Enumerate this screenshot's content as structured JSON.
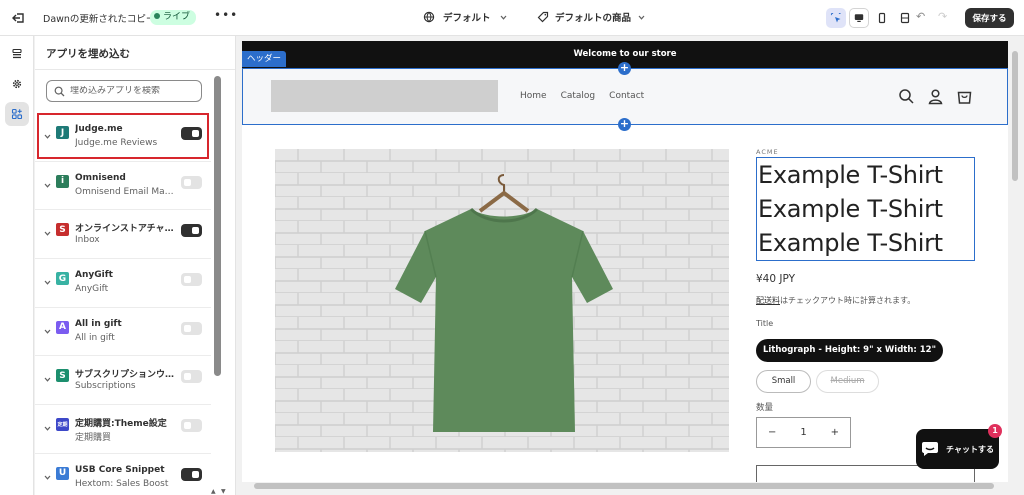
{
  "topbar": {
    "store_title": "Dawnの更新されたコピー",
    "live_label": "ライブ",
    "more_label": "•••",
    "theme_label": "デフォルト",
    "template_label": "デフォルトの商品",
    "save_label": "保存する"
  },
  "panel": {
    "title": "アプリを埋め込む",
    "search_placeholder": "埋め込みアプリを検索",
    "apps": [
      {
        "name": "Judge.me",
        "subtitle": "Judge.me Reviews",
        "enabled": true,
        "icon_letter": "J",
        "icon_color": "#1e7a77"
      },
      {
        "name": "Omnisend",
        "subtitle": "Omnisend Email Marketing",
        "enabled": false,
        "icon_letter": "i",
        "icon_color": "#2c7d5b"
      },
      {
        "name": "オンラインストアチャット",
        "subtitle": "Inbox",
        "enabled": true,
        "icon_letter": "S",
        "icon_color": "#c62e2e"
      },
      {
        "name": "AnyGift",
        "subtitle": "AnyGift",
        "enabled": false,
        "icon_letter": "G",
        "icon_color": "#38b2a3"
      },
      {
        "name": "All in gift",
        "subtitle": "All in gift",
        "enabled": false,
        "icon_letter": "A",
        "icon_color": "#7b5cf0"
      },
      {
        "name": "サブスクリプションウィジェット",
        "subtitle": "Subscriptions",
        "enabled": false,
        "icon_letter": "S",
        "icon_color": "#1c8f6e"
      },
      {
        "name": "定期購買:Theme設定",
        "subtitle": "定期購買",
        "enabled": false,
        "icon_letter": "定期",
        "icon_color": "#3d48c8"
      },
      {
        "name": "USB Core Snippet",
        "subtitle": "Hextom: Sales Boost",
        "enabled": true,
        "icon_letter": "U",
        "icon_color": "#3a7bd5"
      }
    ]
  },
  "preview": {
    "announcement": "Welcome to our store",
    "header_tag": "ヘッダー",
    "nav": [
      "Home",
      "Catalog",
      "Contact"
    ],
    "vendor": "ACME",
    "title_lines": [
      "Example T-Shirt",
      "Example T-Shirt",
      "Example T-Shirt"
    ],
    "price": "¥40 JPY",
    "shipping_link": "配送料",
    "shipping_text": "はチェックアウト時に計算されます。",
    "option_label": "Title",
    "options": {
      "selected": "Lithograph - Height: 9\" x Width: 12\"",
      "small": "Small",
      "medium": "Medium"
    },
    "quantity_label": "数量",
    "quantity_minus": "−",
    "quantity_value": "1",
    "quantity_plus": "+",
    "add_plus": "+",
    "chat_label": "チャットする",
    "chat_badge": "1",
    "shirt_color": "#5e8a5b"
  }
}
